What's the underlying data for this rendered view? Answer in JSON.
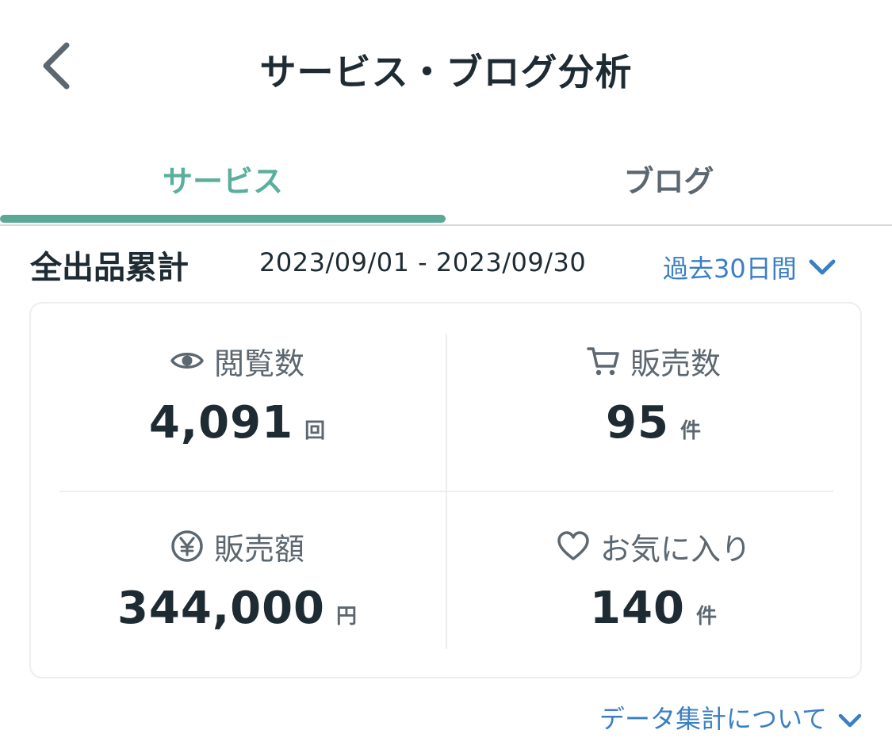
{
  "header": {
    "title": "サービス・ブログ分析",
    "back_icon": "chevron-left-icon"
  },
  "tabs": [
    {
      "label": "サービス",
      "active": true
    },
    {
      "label": "ブログ",
      "active": false
    }
  ],
  "summary": {
    "title": "全出品累計",
    "date_range": "2023/09/01 - 2023/09/30",
    "period": "過去30日間"
  },
  "stats": {
    "views": {
      "label": "閲覧数",
      "value": "4,091",
      "unit": "回",
      "icon": "eye-icon"
    },
    "sales": {
      "label": "販売数",
      "value": "95",
      "unit": "件",
      "icon": "cart-icon"
    },
    "amount": {
      "label": "販売額",
      "value": "344,000",
      "unit": "円",
      "icon": "yen-icon"
    },
    "favorites": {
      "label": "お気に入り",
      "value": "140",
      "unit": "件",
      "icon": "heart-icon"
    }
  },
  "footer": {
    "data_note": "データ集計について"
  },
  "colors": {
    "accent_green": "#5aa897",
    "link_blue": "#3a7fc4",
    "text_dark": "#1f2b33",
    "text_gray": "#5c6770"
  }
}
